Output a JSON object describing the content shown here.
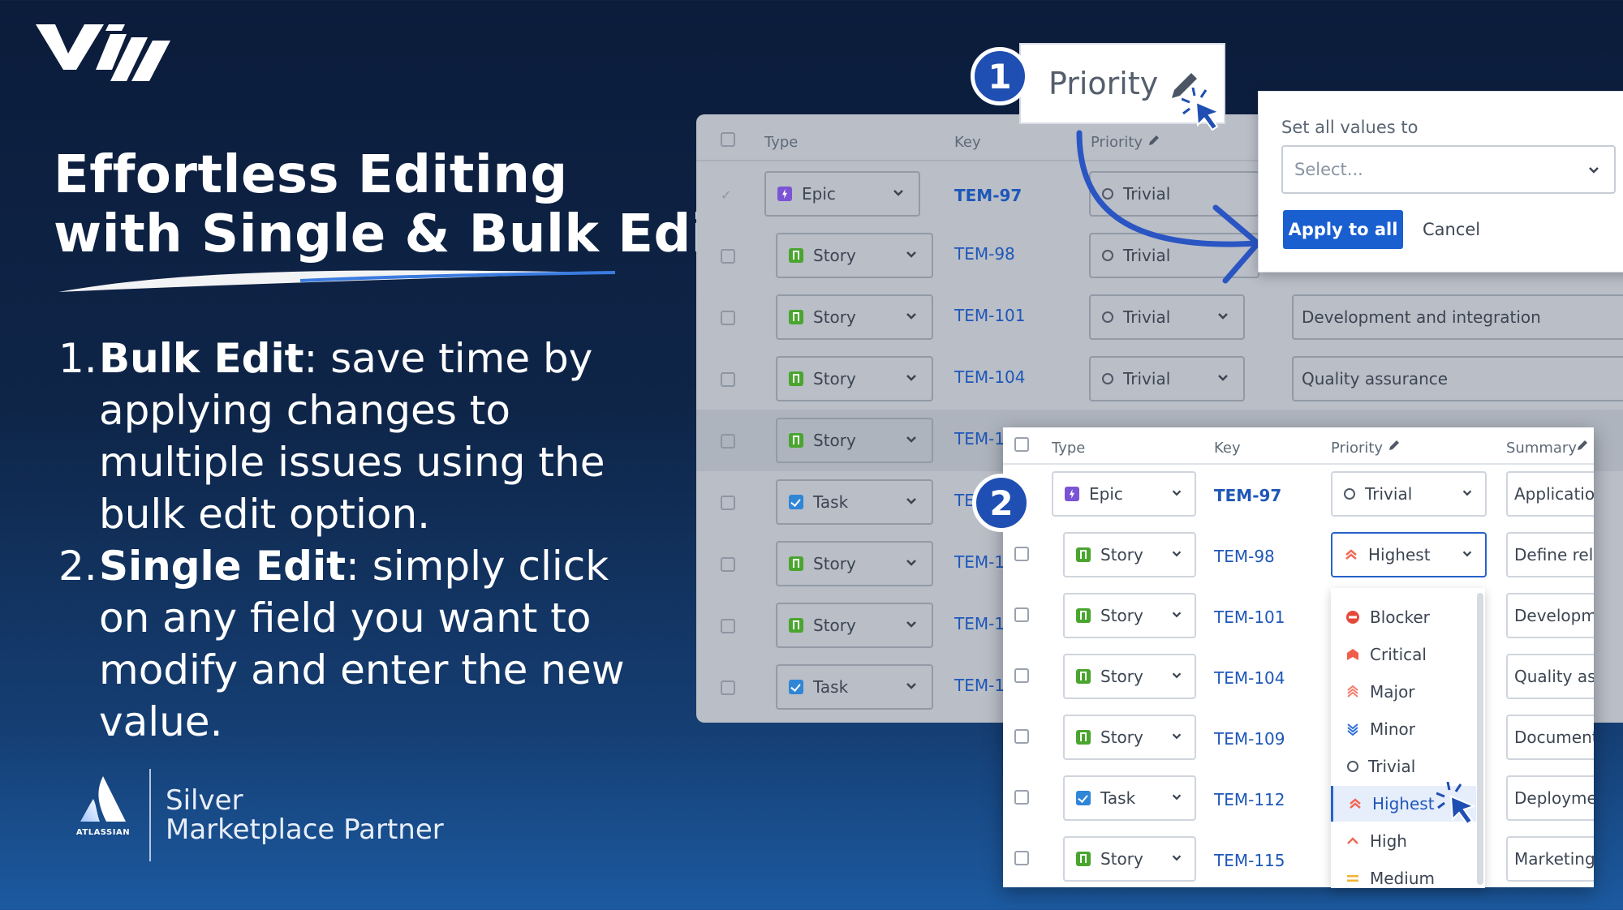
{
  "brand": {
    "logo_text": "Vij"
  },
  "headline": {
    "line1": "Effortless Editing",
    "line2": "with Single & Bulk Edit"
  },
  "bullets": [
    {
      "num": "1.",
      "bold": "Bulk Edit",
      "rest": ": save time by applying changes to multiple issues using the bulk edit option."
    },
    {
      "num": "2.",
      "bold": "Single Edit",
      "rest": ": simply click on any field you want to modify and enter the new value."
    }
  ],
  "partner": {
    "logo_word": "ATLASSIAN",
    "line1": "Silver",
    "line2": "Marketplace Partner"
  },
  "callouts": {
    "badge1": "1",
    "badge2": "2",
    "priority_label": "Priority"
  },
  "bulk_popup": {
    "label": "Set all values to",
    "select_placeholder": "Select...",
    "apply": "Apply to all",
    "cancel": "Cancel"
  },
  "back_table": {
    "headers": {
      "type": "Type",
      "key": "Key",
      "priority": "Priority"
    },
    "rows": [
      {
        "type": "Epic",
        "icon": "epic",
        "key": "TEM-97",
        "priority": "Trivial",
        "summary": ""
      },
      {
        "type": "Story",
        "icon": "story",
        "key": "TEM-98",
        "priority": "Trivial",
        "summary": ""
      },
      {
        "type": "Story",
        "icon": "story",
        "key": "TEM-101",
        "priority": "Trivial",
        "summary": "Development and integration"
      },
      {
        "type": "Story",
        "icon": "story",
        "key": "TEM-104",
        "priority": "Trivial",
        "summary": "Quality assurance"
      },
      {
        "type": "Story",
        "icon": "story",
        "key": "TEM-1",
        "priority": "",
        "summary": ""
      },
      {
        "type": "Task",
        "icon": "task",
        "key": "TE",
        "priority": "",
        "summary": ""
      },
      {
        "type": "Story",
        "icon": "story",
        "key": "TEM-1",
        "priority": "",
        "summary": ""
      },
      {
        "type": "Story",
        "icon": "story",
        "key": "TEM-1",
        "priority": "",
        "summary": ""
      },
      {
        "type": "Task",
        "icon": "task",
        "key": "TEM-1",
        "priority": "",
        "summary": ""
      }
    ]
  },
  "front_table": {
    "headers": {
      "type": "Type",
      "key": "Key",
      "priority": "Priority",
      "summary": "Summary"
    },
    "rows": [
      {
        "type": "Epic",
        "icon": "epic",
        "key": "TEM-97",
        "priority": "Trivial",
        "summary": "Application"
      },
      {
        "type": "Story",
        "icon": "story",
        "key": "TEM-98",
        "priority": "Highest",
        "summary": "Define relea"
      },
      {
        "type": "Story",
        "icon": "story",
        "key": "TEM-101",
        "priority": "",
        "summary": "Developme"
      },
      {
        "type": "Story",
        "icon": "story",
        "key": "TEM-104",
        "priority": "",
        "summary": "Quality ass"
      },
      {
        "type": "Story",
        "icon": "story",
        "key": "TEM-109",
        "priority": "",
        "summary": "Document"
      },
      {
        "type": "Task",
        "icon": "task",
        "key": "TEM-112",
        "priority": "",
        "summary": "Deploymen"
      },
      {
        "type": "Story",
        "icon": "story",
        "key": "TEM-115",
        "priority": "",
        "summary": "Marketing"
      }
    ]
  },
  "priority_dropdown": {
    "options": [
      "Blocker",
      "Critical",
      "Major",
      "Minor",
      "Trivial",
      "Highest",
      "High",
      "Medium"
    ],
    "selected": "Highest"
  },
  "colors": {
    "accent": "#1f4fb2",
    "button": "#1a5fd0",
    "link": "#1e57b8",
    "blocker": "#e5493a",
    "critical": "#f15c4b",
    "major": "#f07a6b",
    "minor": "#2f6fd8",
    "high": "#f06a55",
    "medium": "#f2b134"
  }
}
